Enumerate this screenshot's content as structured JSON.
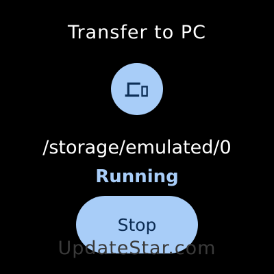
{
  "header": {
    "title": "Transfer to PC"
  },
  "device_icon": {
    "icon": "devices-icon",
    "background_color": "#a8cdf8",
    "icon_color": "#0d2f57"
  },
  "transfer": {
    "path": "/storage/emulated/0",
    "status": "Running",
    "status_color": "#a8cdf8"
  },
  "actions": {
    "stop_label": "Stop",
    "stop_color": "#a8cdf8"
  },
  "watermark": {
    "text": "UpdateStar.com",
    "color": "#3a3a3a"
  }
}
